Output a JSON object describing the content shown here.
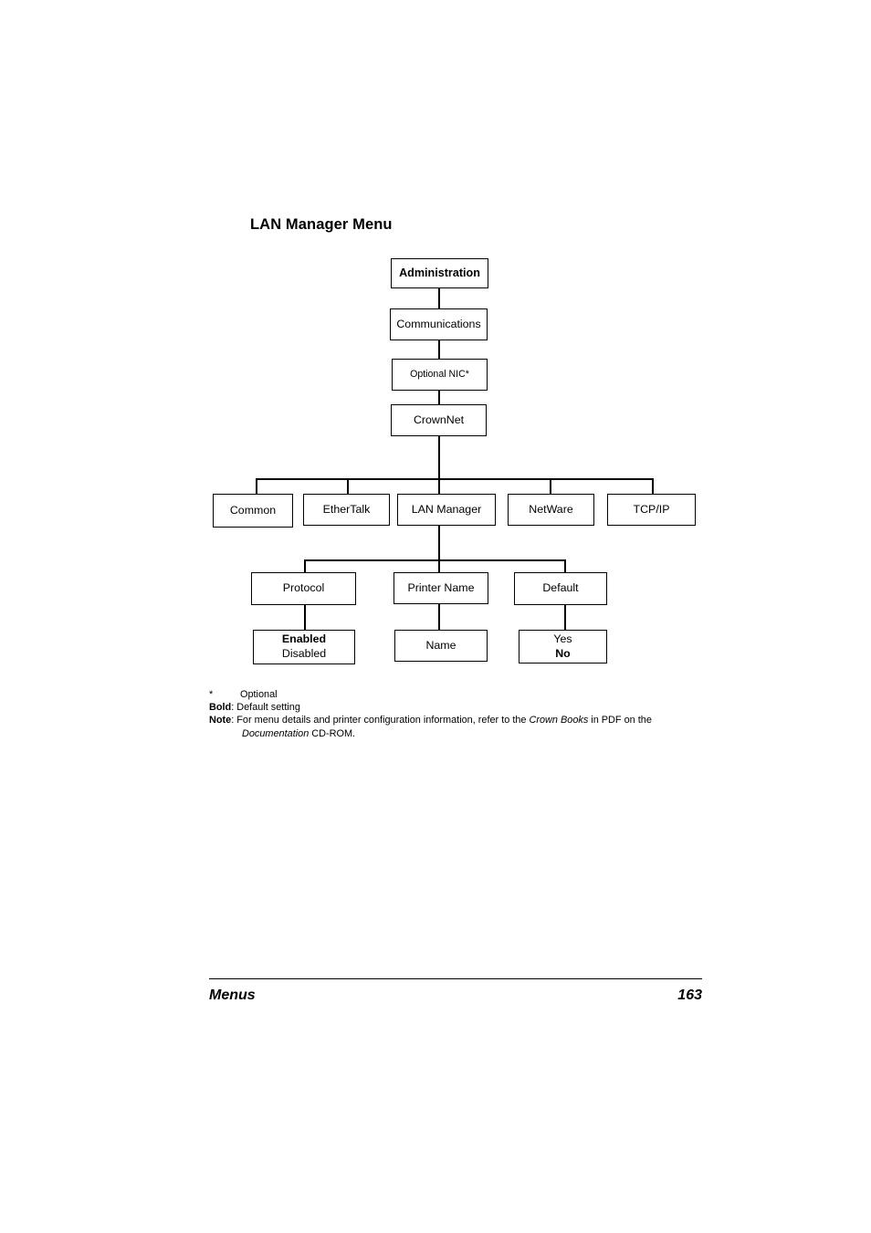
{
  "page": {
    "title": "LAN Manager Menu"
  },
  "diagram": {
    "type": "menu-tree",
    "nodes": {
      "administration": {
        "label": "Administration"
      },
      "communications": {
        "label": "Communications"
      },
      "optional_nic": {
        "label": "Optional NIC*"
      },
      "crownnet": {
        "label": "CrownNet"
      },
      "common": {
        "label": "Common"
      },
      "ethertalk": {
        "label": "EtherTalk"
      },
      "lan_manager": {
        "label": "LAN Manager"
      },
      "netware": {
        "label": "NetWare"
      },
      "tcpip": {
        "label": "TCP/IP"
      },
      "protocol": {
        "label": "Protocol"
      },
      "printer_name": {
        "label": "Printer Name"
      },
      "default": {
        "label": "Default"
      },
      "protocol_values": {
        "line1": "Enabled",
        "line2": "Disabled"
      },
      "printer_name_values": {
        "line1": "Name"
      },
      "default_values": {
        "line1": "Yes",
        "line2": "No"
      }
    }
  },
  "legend": {
    "star_symbol": "*",
    "star_text": "Optional",
    "bold_tag": "Bold",
    "bold_text": ": Default setting",
    "note_tag": "Note",
    "note_text_1": ": For menu details and printer configuration information, refer to the ",
    "note_italic_1": "Crown Books",
    "note_text_2": " in PDF on the",
    "note_italic_2": "Documentation",
    "note_text_3": " CD-ROM."
  },
  "footer": {
    "section": "Menus",
    "page_number": "163"
  }
}
